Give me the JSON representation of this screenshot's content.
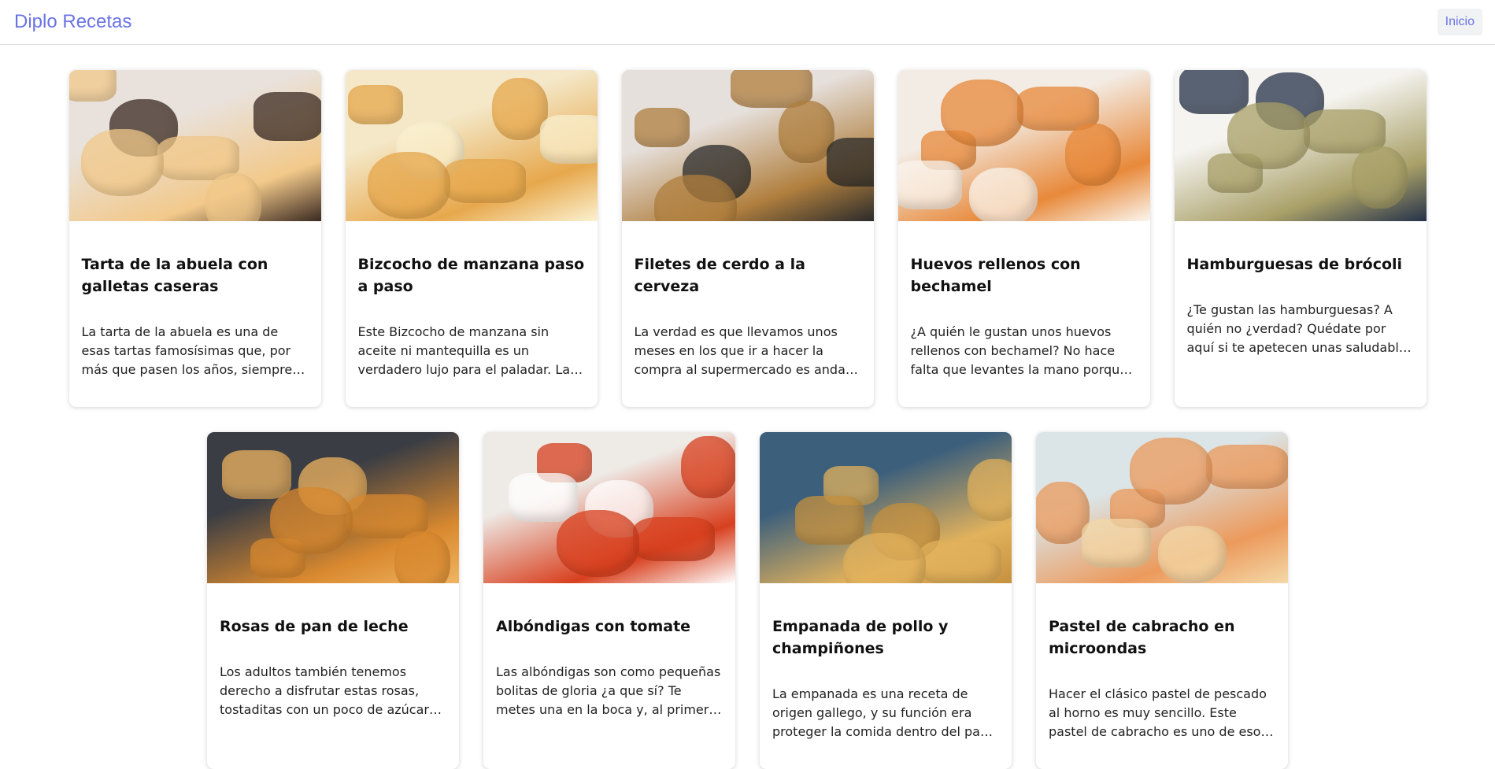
{
  "navbar": {
    "brand": "Diplo Recetas",
    "home_label": "Inicio"
  },
  "recipes": [
    {
      "title": "Tarta de la abuela con galletas caseras",
      "text": "La tarta de la abuela es una de esas tartas famosísimas que, por más que pasen los años, siempre triunfa.",
      "image": "layered-chocolate-cake-photo",
      "colors": [
        "#e9e2dc",
        "#f2c98a",
        "#3b2a22"
      ]
    },
    {
      "title": "Bizcocho de manzana paso a paso",
      "text": "Este Bizcocho de manzana sin aceite ni mantequilla es un verdadero lujo para el paladar. La manzana le da un toque delicioso.",
      "image": "apple-sponge-cake-photo",
      "colors": [
        "#f4e8c8",
        "#e7a84c",
        "#fbf1d0"
      ]
    },
    {
      "title": "Filetes de cerdo a la cerveza",
      "text": "La verdad es que llevamos unos meses en los que ir a hacer la compra al supermercado es andar de susto en susto.",
      "image": "pork-beer-stew-photo",
      "colors": [
        "#e6e0dc",
        "#b07f3e",
        "#2b2b2b"
      ]
    },
    {
      "title": "Huevos rellenos con bechamel",
      "text": "¿A quién le gustan unos huevos rellenos con bechamel? No hace falta que levantes la mano porque estos triunfan siempre.",
      "image": "stuffed-eggs-bechamel-photo",
      "colors": [
        "#f3ece4",
        "#e8893a",
        "#fbf6ef"
      ]
    },
    {
      "title": "Hamburguesas de brócoli",
      "text": "¿Te gustan las hamburguesas? A quién no ¿verdad? Quédate por aquí si te apetecen unas saludables y deliciosas.",
      "image": "broccoli-burgers-photo",
      "colors": [
        "#f5f4f0",
        "#a9a068",
        "#25324a"
      ]
    },
    {
      "title": "Rosas de pan de leche",
      "text": "Los adultos también tenemos derecho a disfrutar estas rosas, tostaditas con un poco de azúcar por encima.",
      "image": "milk-bread-roses-photo",
      "colors": [
        "#3a3d44",
        "#d9892f",
        "#f0b561"
      ]
    },
    {
      "title": "Albóndigas con tomate",
      "text": "Las albóndigas son como pequeñas bolitas de gloria ¿a que sí? Te metes una en la boca y, al primer mordisco ya sabes.",
      "image": "meatballs-tomato-photo",
      "colors": [
        "#eeeae6",
        "#d8401e",
        "#ffffff"
      ]
    },
    {
      "title": "Empanada de pollo y champiñones",
      "text": "La empanada es una receta de origen gallego, y su función era proteger la comida dentro del pan para llevarla.",
      "image": "chicken-empanada-photo",
      "colors": [
        "#3c5f7c",
        "#e2b25c",
        "#c6913f"
      ]
    },
    {
      "title": "Pastel de cabracho en microondas",
      "text": "Hacer el clásico pastel de pescado al horno es muy sencillo. Este pastel de cabracho es uno de esos entrantes que gustan.",
      "image": "scorpionfish-pie-photo",
      "colors": [
        "#dbe5e7",
        "#ec9a5c",
        "#f4d9a8"
      ]
    }
  ]
}
